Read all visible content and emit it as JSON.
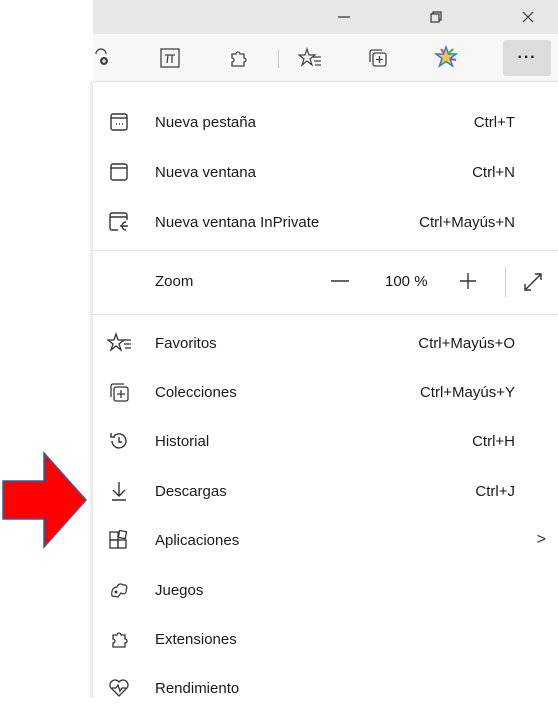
{
  "window": {
    "minimize_icon": "minimize-icon",
    "restore_icon": "restore-icon",
    "close_icon": "close-icon"
  },
  "toolbar": {
    "icons": [
      "partial-extension-icon",
      "math-solver-icon",
      "extensions-icon",
      "favorites-icon",
      "collections-icon",
      "copilot-star-icon",
      "more-icon"
    ],
    "more_label": "···"
  },
  "menu": {
    "items_top": [
      {
        "label": "Nueva pestaña",
        "shortcut": "Ctrl+T",
        "icon": "new-tab-icon"
      },
      {
        "label": "Nueva ventana",
        "shortcut": "Ctrl+N",
        "icon": "new-window-icon"
      },
      {
        "label": "Nueva ventana InPrivate",
        "shortcut": "Ctrl+Mayús+N",
        "icon": "inprivate-icon"
      }
    ],
    "zoom": {
      "label": "Zoom",
      "value": "100 %",
      "minus": "—",
      "plus": "+"
    },
    "items": [
      {
        "label": "Favoritos",
        "shortcut": "Ctrl+Mayús+O",
        "icon": "favorites-icon"
      },
      {
        "label": "Colecciones",
        "shortcut": "Ctrl+Mayús+Y",
        "icon": "collections-icon"
      },
      {
        "label": "Historial",
        "shortcut": "Ctrl+H",
        "icon": "history-icon"
      },
      {
        "label": "Descargas",
        "shortcut": "Ctrl+J",
        "icon": "download-icon"
      },
      {
        "label": "Aplicaciones",
        "shortcut": "",
        "icon": "apps-icon",
        "chevron": ">"
      },
      {
        "label": "Juegos",
        "shortcut": "",
        "icon": "games-icon"
      },
      {
        "label": "Extensiones",
        "shortcut": "",
        "icon": "extensions-icon"
      },
      {
        "label": "Rendimiento",
        "shortcut": "",
        "icon": "performance-icon"
      }
    ]
  },
  "annotation": {
    "arrow_color": "#ff0000",
    "arrow_stroke": "#3b5aa0"
  }
}
